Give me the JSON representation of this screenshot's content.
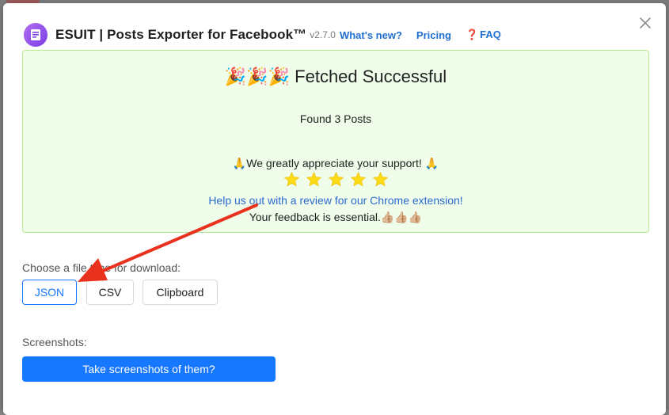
{
  "header": {
    "title": "ESUIT | Posts Exporter for Facebook™",
    "version": "v2.7.0",
    "links": {
      "whats_new": "What's new?",
      "pricing": "Pricing",
      "faq_mark": "❓",
      "faq": "FAQ"
    }
  },
  "result": {
    "title_emoji": "🎉🎉🎉",
    "title": "Fetched Successful",
    "found": "Found 3 Posts",
    "appreciate_prefix": "🙏",
    "appreciate": "We greatly appreciate your support!",
    "appreciate_suffix": "🙏",
    "star_count": 5,
    "review_link": "Help us out with a review for our Chrome extension!",
    "feedback": "Your feedback is essential.",
    "feedback_emoji": "👍🏼👍🏼👍🏼"
  },
  "download": {
    "label": "Choose a file type for download:",
    "options": [
      "JSON",
      "CSV",
      "Clipboard"
    ],
    "selected": "JSON"
  },
  "screenshots": {
    "label": "Screenshots:",
    "button": "Take screenshots of them?"
  },
  "colors": {
    "accent": "#1677ff",
    "success_bg": "#f0fdea",
    "success_border": "#b7eb8f",
    "annotation_arrow": "#e8321e",
    "star": "#fadb14"
  }
}
